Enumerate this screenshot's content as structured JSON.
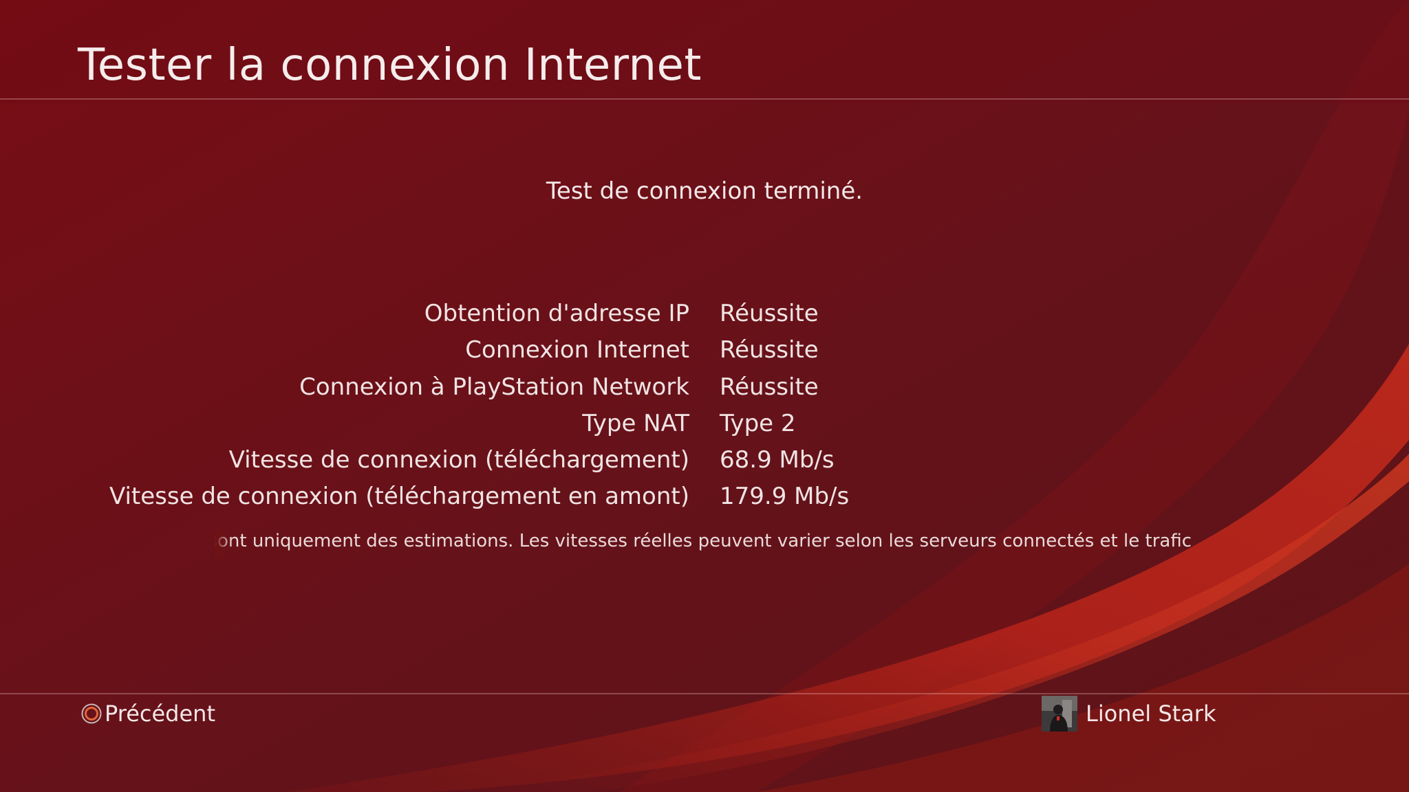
{
  "header": {
    "title": "Tester la connexion Internet"
  },
  "status": {
    "message": "Test de connexion terminé."
  },
  "results": [
    {
      "label": "Obtention d'adresse IP",
      "value": "Réussite"
    },
    {
      "label": "Connexion Internet",
      "value": "Réussite"
    },
    {
      "label": "Connexion à PlayStation Network",
      "value": "Réussite"
    },
    {
      "label": "Type NAT",
      "value": "Type 2"
    },
    {
      "label": "Vitesse de connexion (téléchargement)",
      "value": "68.9 Mb/s"
    },
    {
      "label": "Vitesse de connexion (téléchargement en amont)",
      "value": "179.9 Mb/s"
    }
  ],
  "note": {
    "text": "exion sont uniquement des estimations. Les vitesses réelles peuvent varier selon les serveurs connectés et le trafic"
  },
  "footer": {
    "back_label": "Précédent",
    "back_icon": "circle-button-icon",
    "user_name": "Lionel Stark",
    "avatar_icon": "user-avatar"
  },
  "colors": {
    "background": "#6a0f15",
    "accent_wave": "#b8231a",
    "circle_button": "#e0673a"
  }
}
